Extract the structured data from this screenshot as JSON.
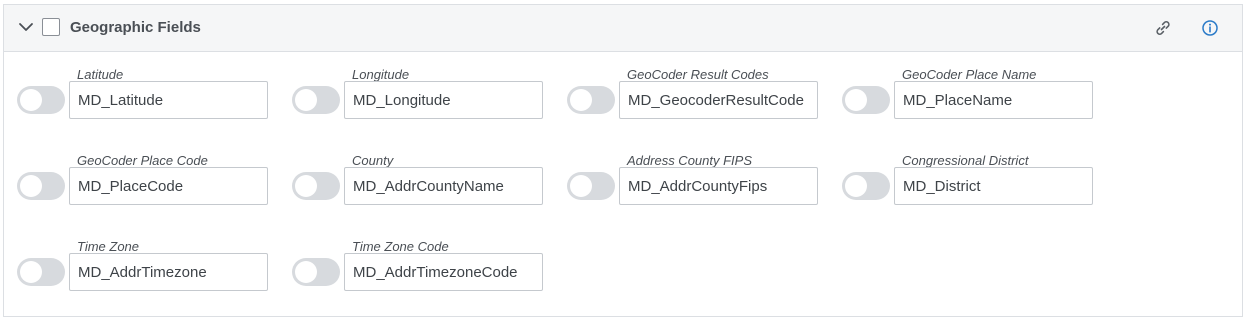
{
  "section": {
    "title": "Geographic Fields",
    "icons": {
      "expand": "chevron-down-icon",
      "select": "checkbox",
      "link": "link-icon",
      "info": "info-icon"
    },
    "accent_color": "#2a7ac8"
  },
  "fields": [
    {
      "label": "Latitude",
      "value": "MD_Latitude"
    },
    {
      "label": "Longitude",
      "value": "MD_Longitude"
    },
    {
      "label": "GeoCoder Result Codes",
      "value": "MD_GeocoderResultCode"
    },
    {
      "label": "GeoCoder Place Name",
      "value": "MD_PlaceName"
    },
    {
      "label": "GeoCoder Place Code",
      "value": "MD_PlaceCode"
    },
    {
      "label": "County",
      "value": "MD_AddrCountyName"
    },
    {
      "label": "Address County FIPS",
      "value": "MD_AddrCountyFips"
    },
    {
      "label": "Congressional District",
      "value": "MD_District"
    },
    {
      "label": "Time Zone",
      "value": "MD_AddrTimezone"
    },
    {
      "label": "Time Zone Code",
      "value": "MD_AddrTimezoneCode"
    }
  ]
}
